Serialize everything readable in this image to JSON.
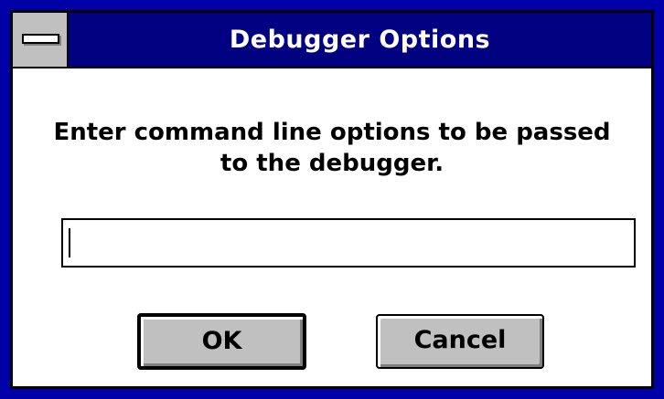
{
  "dialog": {
    "title": "Debugger Options",
    "message_line1": "Enter command line options to be passed",
    "message_line2": "to the debugger.",
    "input": {
      "value": "",
      "placeholder": ""
    },
    "buttons": {
      "ok_label": "OK",
      "cancel_label": "Cancel"
    }
  },
  "colors": {
    "frame": "#0000a8",
    "titlebar": "#000080",
    "title_text": "#ffffff",
    "button_face": "#c0c0c0",
    "client": "#ffffff"
  },
  "icons": {
    "system_menu": "system-menu-icon"
  }
}
